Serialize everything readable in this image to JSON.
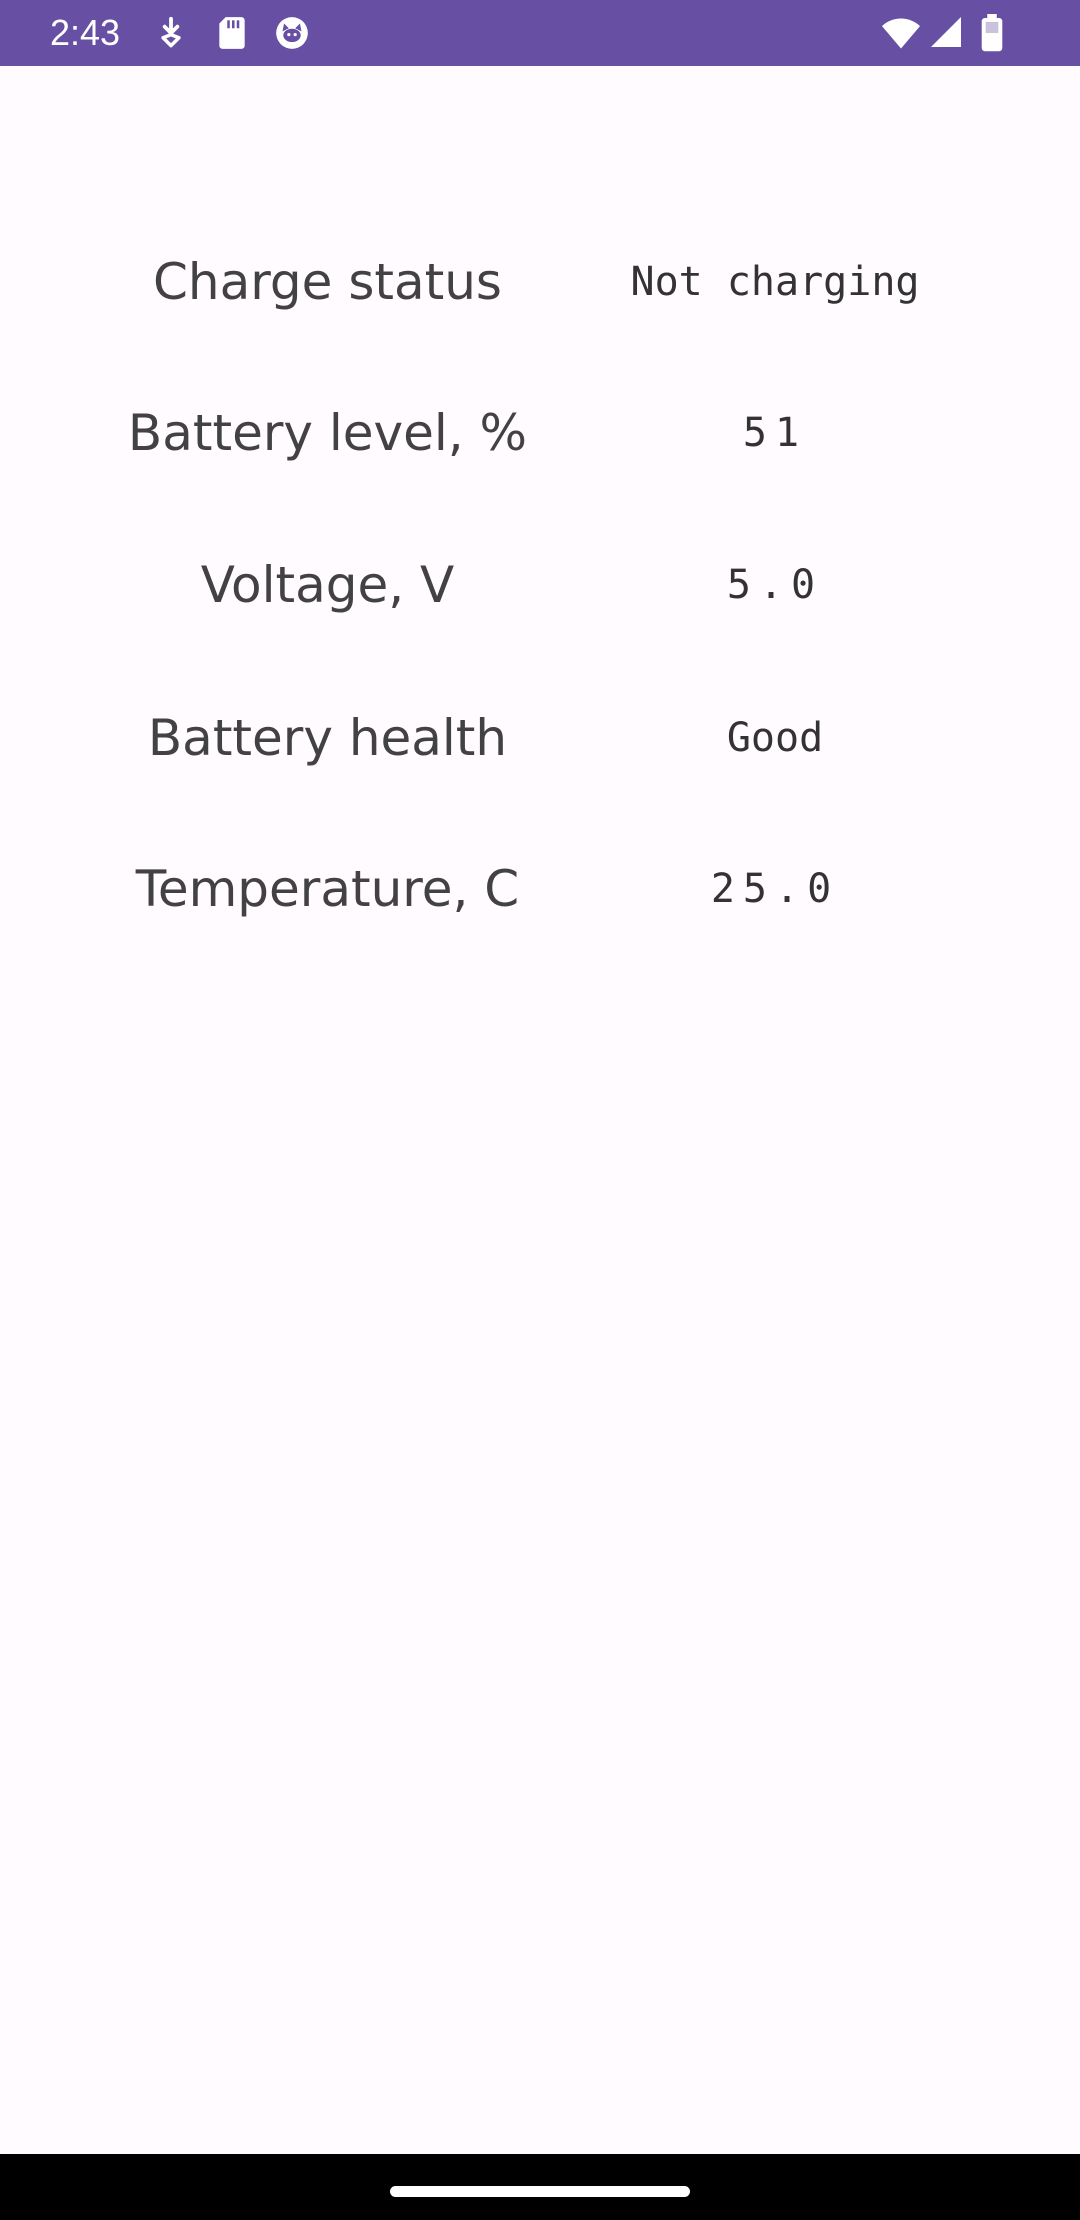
{
  "status_bar": {
    "time": "2:43",
    "background_color": "#6750A4",
    "icons_left": [
      "download-arrow-icon",
      "sd-card-icon",
      "cat-face-icon"
    ],
    "icons_right": [
      "wifi-icon",
      "cell-signal-icon",
      "battery-icon"
    ]
  },
  "battery_info": {
    "rows": [
      {
        "label": "Charge status",
        "value": "Not charging"
      },
      {
        "label": "Battery level, %",
        "value": "51"
      },
      {
        "label": "Voltage, V",
        "value": "5.0"
      },
      {
        "label": "Battery health",
        "value": "Good"
      },
      {
        "label": "Temperature, C",
        "value": "25.0"
      }
    ]
  },
  "colors": {
    "accent": "#6750A4",
    "background": "#FFFBFE",
    "label_text": "#424242",
    "value_text": "#333333"
  }
}
